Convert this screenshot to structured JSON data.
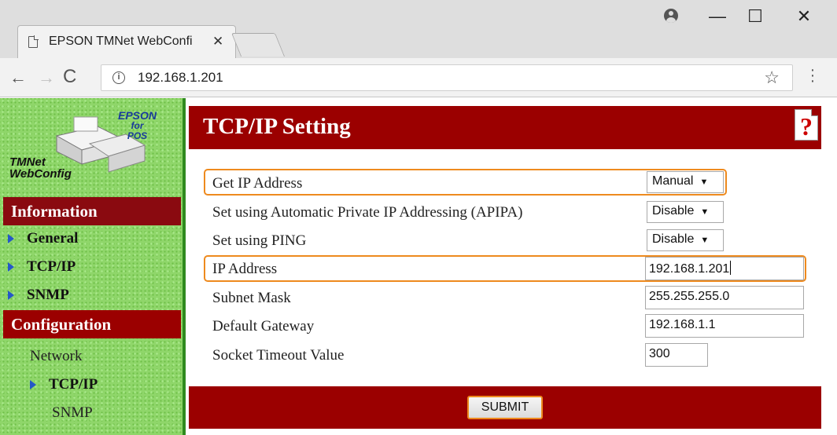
{
  "browser": {
    "tab_title": "EPSON TMNet WebConfi",
    "tab_close": "✕",
    "url": "192.168.1.201",
    "back": "←",
    "forward": "→",
    "reload": "C",
    "star": "☆",
    "minimize": "—",
    "maximize": "☐",
    "close": "✕"
  },
  "logo": {
    "epson_line1": "EPSON",
    "epson_line2": "for",
    "epson_line3": "POS",
    "tmnet_line1": "TMNet",
    "tmnet_line2": "WebConfig"
  },
  "sidebar": {
    "information_header": "Information",
    "info_items": [
      {
        "label": "General"
      },
      {
        "label": "TCP/IP"
      },
      {
        "label": "SNMP"
      }
    ],
    "configuration_header": "Configuration",
    "network_label": "Network",
    "config_items": [
      {
        "label": "TCP/IP"
      },
      {
        "label": "SNMP"
      }
    ]
  },
  "main": {
    "title": "TCP/IP Setting",
    "help_glyph": "?",
    "fields": [
      {
        "label": "Get IP Address",
        "value": "Manual"
      },
      {
        "label": "Set using Automatic Private IP Addressing (APIPA)",
        "value": "Disable"
      },
      {
        "label": "Set using PING",
        "value": "Disable"
      },
      {
        "label": "IP Address",
        "value": "192.168.1.201"
      },
      {
        "label": "Subnet Mask",
        "value": "255.255.255.0"
      },
      {
        "label": "Default Gateway",
        "value": "192.168.1.1"
      },
      {
        "label": "Socket Timeout Value",
        "value": "300"
      }
    ],
    "submit_label": "SUBMIT"
  },
  "colors": {
    "header_red": "#9b0000",
    "sidebar_green": "#8fd66a",
    "highlight_orange": "#ee8a1e"
  }
}
